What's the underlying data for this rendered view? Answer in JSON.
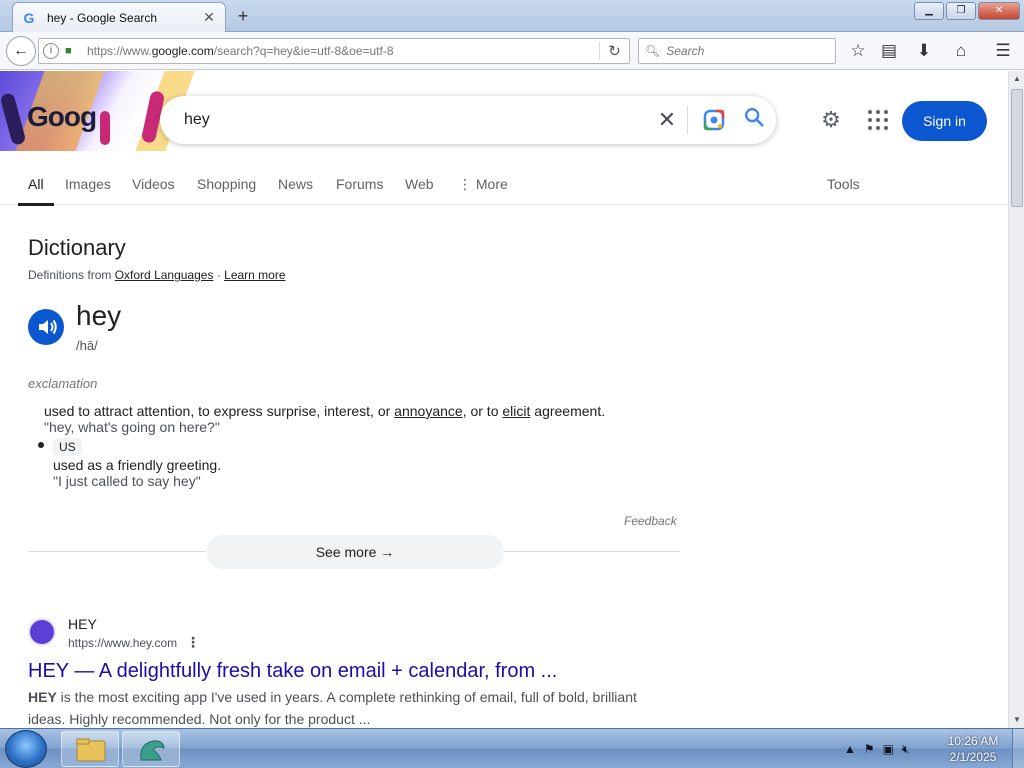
{
  "browser": {
    "tab_title": "hey - Google Search",
    "tab_favicon": "G",
    "new_tab": "+",
    "url_host_prefix": "https://www.",
    "url_host": "google.com",
    "url_path": "/search?q=hey&ie=utf-8&oe=utf-8",
    "search_placeholder": "Search"
  },
  "google": {
    "doodle_text": "Goog",
    "query": "hey",
    "signin_label": "Sign in",
    "tabs": [
      "All",
      "Images",
      "Videos",
      "Shopping",
      "News",
      "Forums",
      "Web",
      "⋮ More"
    ],
    "tools_label": "Tools",
    "accent": "#0b57d0"
  },
  "dictionary": {
    "heading": "Dictionary",
    "definitions_from": "Definitions from",
    "source": "Oxford Languages",
    "separator": "·",
    "learn_more": "Learn more",
    "word": "hey",
    "phonetic": "/hā/",
    "part_of_speech": "exclamation",
    "def1_pre": "used to attract attention, to express surprise, interest, or ",
    "def1_link1": "annoyance",
    "def1_mid": ", or to ",
    "def1_link2": "elicit",
    "def1_post": " agreement.",
    "example1": "\"hey, what's going on here?\"",
    "region_tag": "US",
    "def2": "used as a friendly greeting.",
    "example2": "\"I just called to say hey\"",
    "feedback": "Feedback",
    "see_more": "See more"
  },
  "result": {
    "site_name": "HEY",
    "site_url": "https://www.hey.com",
    "title": "HEY — A delightfully fresh take on email + calendar, from ...",
    "snippet_bold": "HEY",
    "snippet_line1": " is the most exciting app I've used in years. A complete rethinking of email, full of bold, brilliant",
    "snippet_line2": "ideas. Highly recommended. Not only for the product ..."
  },
  "taskbar": {
    "time": "10:26 AM",
    "date": "2/1/2025"
  }
}
